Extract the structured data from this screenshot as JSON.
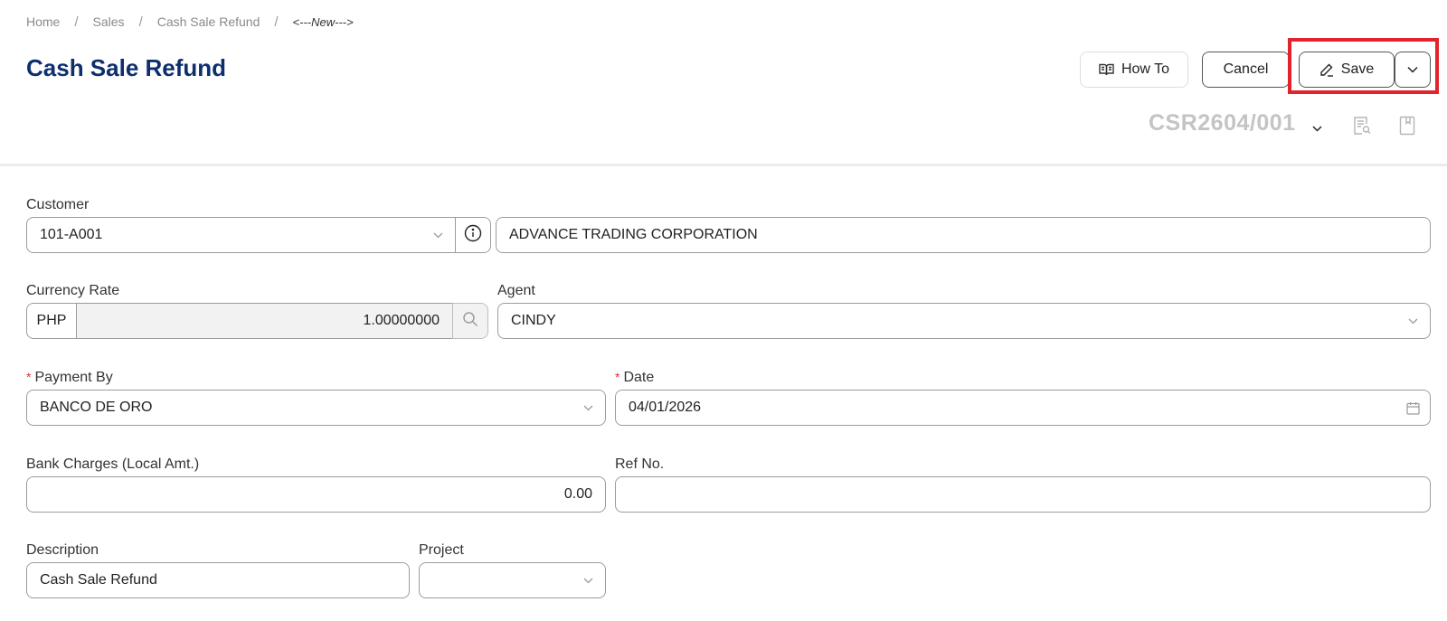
{
  "breadcrumb": {
    "items": [
      "Home",
      "Sales",
      "Cash Sale Refund"
    ],
    "separator": "/",
    "current": "<---New--->"
  },
  "page_title": "Cash Sale Refund",
  "actions": {
    "how_to_label": "How To",
    "cancel_label": "Cancel",
    "save_label": "Save"
  },
  "document": {
    "number": "CSR2604/001"
  },
  "form": {
    "customer": {
      "label": "Customer",
      "code": "101-A001",
      "name": "ADVANCE TRADING CORPORATION"
    },
    "currency_rate": {
      "label": "Currency Rate",
      "currency": "PHP",
      "rate": "1.00000000"
    },
    "agent": {
      "label": "Agent",
      "value": "CINDY"
    },
    "payment_by": {
      "label": "Payment By",
      "required_mark": "*",
      "value": "BANCO DE ORO"
    },
    "date": {
      "label": "Date",
      "required_mark": "*",
      "value": "04/01/2026"
    },
    "bank_charges": {
      "label": "Bank Charges (Local Amt.)",
      "value": "0.00"
    },
    "ref_no": {
      "label": "Ref No.",
      "value": ""
    },
    "description": {
      "label": "Description",
      "value": "Cash Sale Refund"
    },
    "project": {
      "label": "Project",
      "value": ""
    }
  },
  "colors": {
    "title": "#0e2f6e",
    "highlight": "#e3232b",
    "required": "#e0313a",
    "doc_number": "#c4c4c4"
  },
  "icons": [
    "book-icon",
    "pencil-icon",
    "chevron-down-icon",
    "info-icon",
    "search-icon",
    "calendar-icon",
    "document-search-icon",
    "bookmark-icon"
  ]
}
